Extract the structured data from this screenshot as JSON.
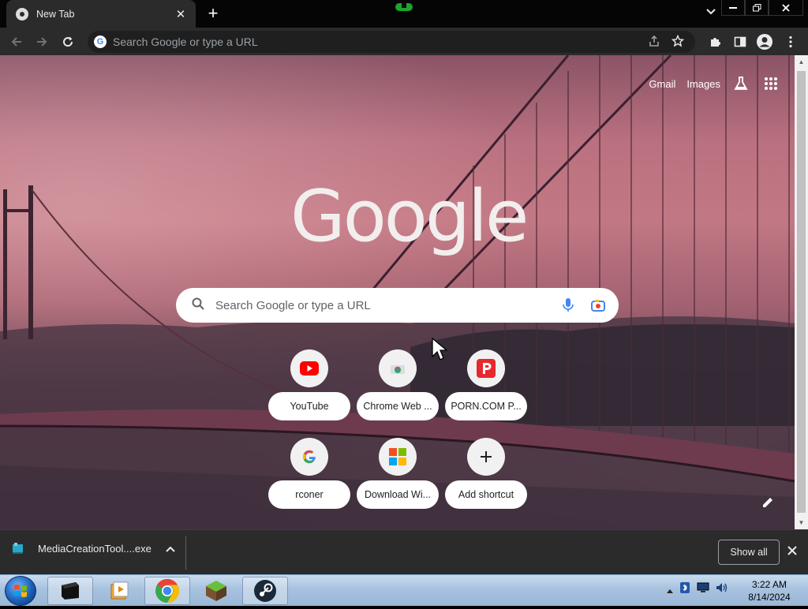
{
  "browser": {
    "tab": {
      "title": "New Tab"
    },
    "omnibox": {
      "placeholder": "Search Google or type a URL"
    }
  },
  "ntp": {
    "top_links": {
      "gmail": "Gmail",
      "images": "Images"
    },
    "logo": "Google",
    "search": {
      "placeholder": "Search Google or type a URL"
    },
    "shortcuts": [
      {
        "label": "YouTube",
        "icon": "youtube-icon"
      },
      {
        "label": "Chrome Web ...",
        "icon": "chrome-web-store-icon"
      },
      {
        "label": "PORN.COM P...",
        "icon": "p-logo-icon"
      },
      {
        "label": "rconer",
        "icon": "google-g-icon"
      },
      {
        "label": "Download Wi...",
        "icon": "microsoft-icon"
      },
      {
        "label": "Add shortcut",
        "icon": "plus-icon"
      }
    ]
  },
  "downloads": {
    "file_name": "MediaCreationTool....exe",
    "show_all": "Show all"
  },
  "taskbar": {
    "time": "3:22 AM",
    "date": "8/14/2024"
  },
  "colors": {
    "chrome_dark": "#2b2b2b",
    "tab_strip": "#050505",
    "youtube_red": "#ff0000",
    "p_logo_red": "#e7282e"
  }
}
